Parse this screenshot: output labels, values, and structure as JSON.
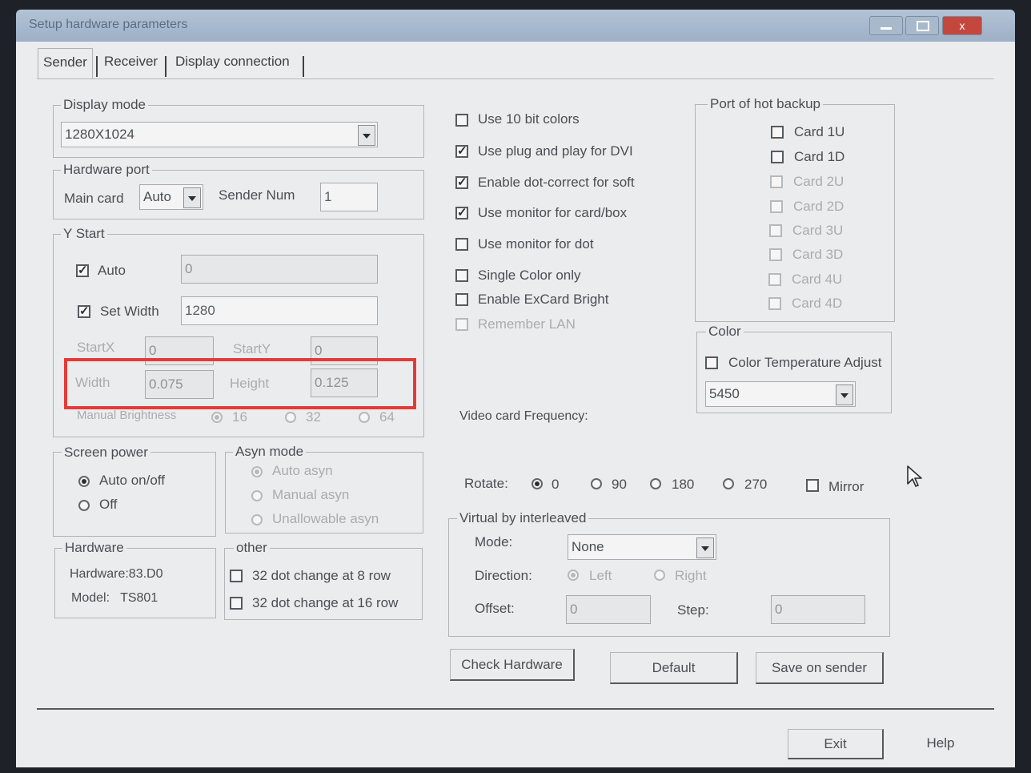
{
  "window": {
    "title": "Setup hardware parameters",
    "close_glyph": "x"
  },
  "tabs": [
    "Sender",
    "Receiver",
    "Display connection"
  ],
  "display_mode": {
    "legend": "Display mode",
    "value": "1280X1024"
  },
  "hardware_port": {
    "legend": "Hardware port",
    "main_card_label": "Main card",
    "main_card_value": "Auto",
    "sender_num_label": "Sender Num",
    "sender_num_value": "1"
  },
  "y_start": {
    "legend": "Y Start",
    "auto_label": "Auto",
    "auto_value": "0",
    "set_width_label": "Set Width",
    "set_width_value": "1280",
    "startx_label": "StartX",
    "startx_value": "0",
    "starty_label": "StartY",
    "starty_value": "0",
    "width_label": "Width",
    "width_value": "0.075",
    "height_label": "Height",
    "height_value": "0.125",
    "brightness_label": "Manual Brightness",
    "brightness_options": [
      "16",
      "32",
      "64"
    ]
  },
  "screen_power": {
    "legend": "Screen power",
    "options": [
      "Auto on/off",
      "Off"
    ]
  },
  "asyn_mode": {
    "legend": "Asyn mode",
    "options": [
      "Auto asyn",
      "Manual asyn",
      "Unallowable asyn"
    ]
  },
  "hardware": {
    "legend": "Hardware",
    "version": "Hardware:83.D0",
    "model": "Model:   TS801"
  },
  "other": {
    "legend": "other",
    "options": [
      "32 dot change at 8 row",
      "32 dot change at 16 row"
    ]
  },
  "options": [
    {
      "label": "Use 10 bit colors",
      "checked": false,
      "enabled": true
    },
    {
      "label": "Use plug and play for DVI",
      "checked": true,
      "enabled": true
    },
    {
      "label": "Enable dot-correct for soft",
      "checked": true,
      "enabled": true
    },
    {
      "label": "Use monitor for card/box",
      "checked": true,
      "enabled": true
    },
    {
      "label": "Use monitor for dot",
      "checked": false,
      "enabled": true
    },
    {
      "label": "Single Color only",
      "checked": false,
      "enabled": true
    },
    {
      "label": "Enable ExCard Bright",
      "checked": false,
      "enabled": true
    },
    {
      "label": "Remember LAN",
      "checked": false,
      "enabled": false
    }
  ],
  "check_glyph": "✓",
  "hot_backup": {
    "legend": "Port of hot backup",
    "cards": [
      "Card 1U",
      "Card 1D",
      "Card 2U",
      "Card 2D",
      "Card 3U",
      "Card 3D",
      "Card 4U",
      "Card 4D"
    ]
  },
  "color": {
    "legend": "Color",
    "temp_label": "Color Temperature Adjust",
    "temp_value": "5450"
  },
  "video_freq_label": "Video card Frequency:",
  "rotate": {
    "label": "Rotate:",
    "options": [
      "0",
      "90",
      "180",
      "270"
    ],
    "mirror_label": "Mirror"
  },
  "virtual": {
    "legend": "Virtual by interleaved",
    "mode_label": "Mode:",
    "mode_value": "None",
    "direction_label": "Direction:",
    "direction_options": [
      "Left",
      "Right"
    ],
    "offset_label": "Offset:",
    "offset_value": "0",
    "step_label": "Step:",
    "step_value": "0"
  },
  "buttons": {
    "check_hardware": "Check Hardware",
    "default": "Default",
    "save_on_sender": "Save on sender",
    "exit": "Exit",
    "help": "Help"
  }
}
